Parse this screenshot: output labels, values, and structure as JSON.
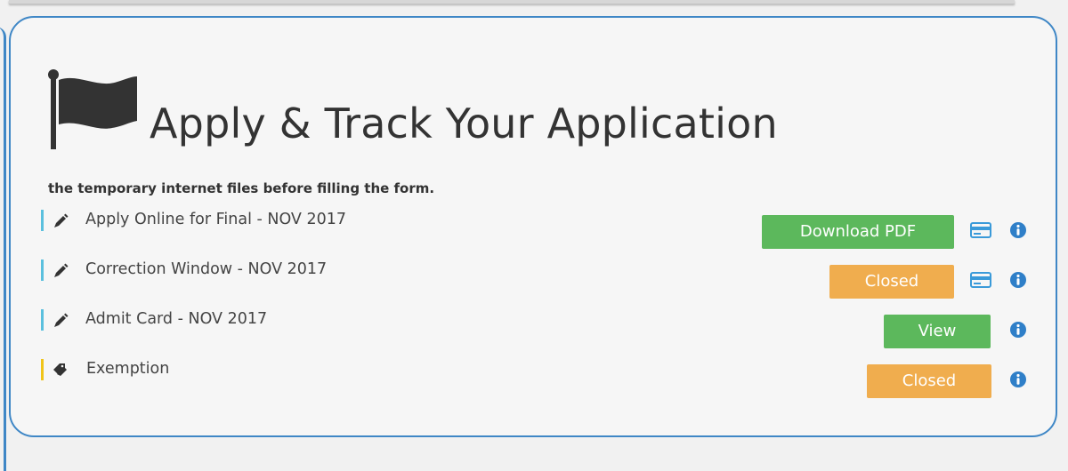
{
  "header": {
    "title": "Apply & Track Your Application",
    "notice": "the temporary internet files before filling the form."
  },
  "icons": {
    "header": "flag-icon",
    "row_edit": "pencil-icon",
    "row_exemption": "tags-icon",
    "payment": "credit-card-icon",
    "info": "info-circle-icon"
  },
  "colors": {
    "panel_border": "#3f87c6",
    "green": "#5cb85c",
    "orange": "#f0ad4e",
    "row_marker_blue": "#5bc0de",
    "row_marker_yellow": "#f0c419"
  },
  "items": [
    {
      "label": "Apply Online for Final - NOV 2017",
      "button": "Download PDF",
      "status": "open"
    },
    {
      "label": "Correction Window - NOV 2017",
      "button": "Closed",
      "status": "closed"
    },
    {
      "label": "Admit Card - NOV 2017",
      "button": "View",
      "status": "open"
    },
    {
      "label": "Exemption",
      "button": "Closed",
      "status": "closed"
    }
  ]
}
